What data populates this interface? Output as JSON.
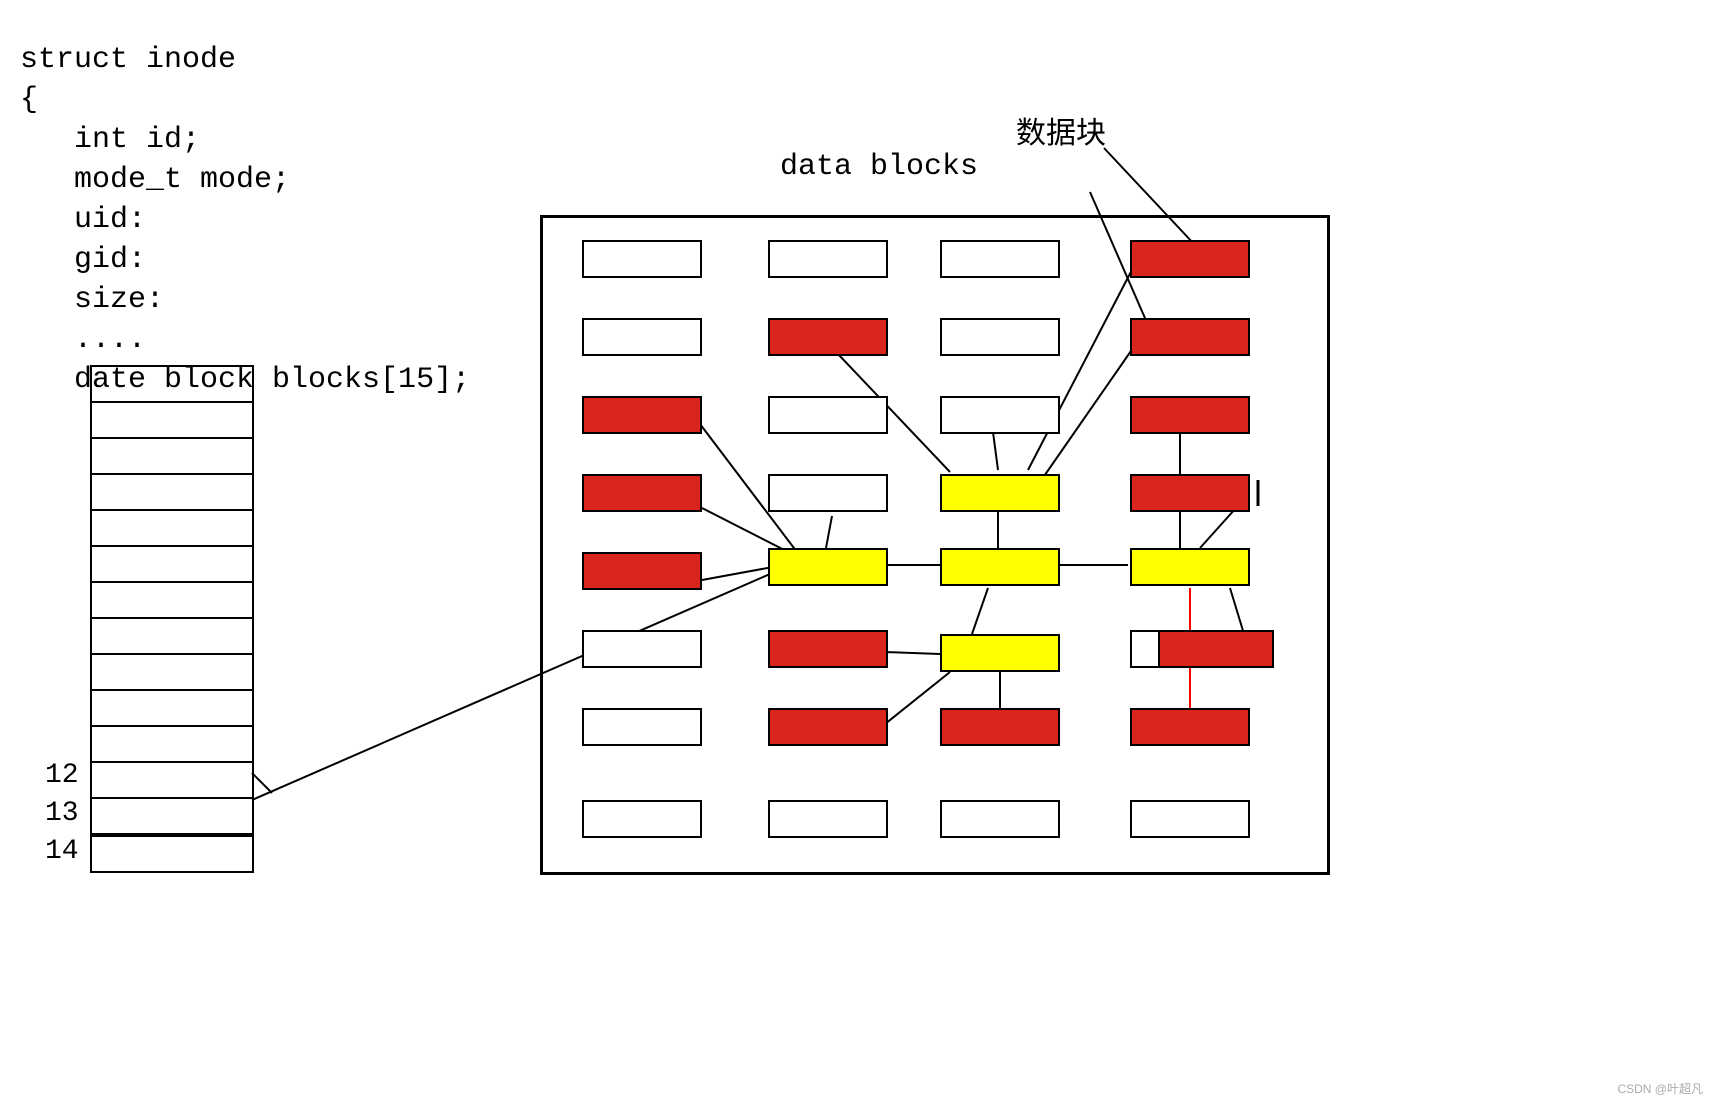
{
  "code": {
    "line1": "struct inode",
    "line2": "{",
    "line3": "   int id;",
    "line4": "   mode_t mode;",
    "line5": "   uid:",
    "line6": "   gid:",
    "line7": "   size:",
    "line8": "   ....",
    "line9": "   date block blocks[15];"
  },
  "array_indices": {
    "a": "12",
    "b": "13",
    "c": "14"
  },
  "labels": {
    "data_blocks": "data blocks",
    "annotation": "数据块"
  },
  "colors": {
    "red": "#da251c",
    "yellow": "#ffff00",
    "white": "#ffffff",
    "black": "#000000"
  },
  "grid": {
    "rows": 8,
    "cols": 4,
    "cells": [
      [
        "white",
        "white",
        "white",
        "red"
      ],
      [
        "white",
        "red",
        "white",
        "red"
      ],
      [
        "red",
        "white",
        "white",
        "red"
      ],
      [
        "red",
        "white",
        "yellow",
        "red"
      ],
      [
        "red",
        "yellow",
        "yellow",
        "yellow"
      ],
      [
        "white",
        "red",
        "yellow",
        "red"
      ],
      [
        "white",
        "red",
        "red",
        "red"
      ],
      [
        "white",
        "white",
        "white",
        "white"
      ]
    ]
  },
  "watermark": "CSDN @叶超凡"
}
